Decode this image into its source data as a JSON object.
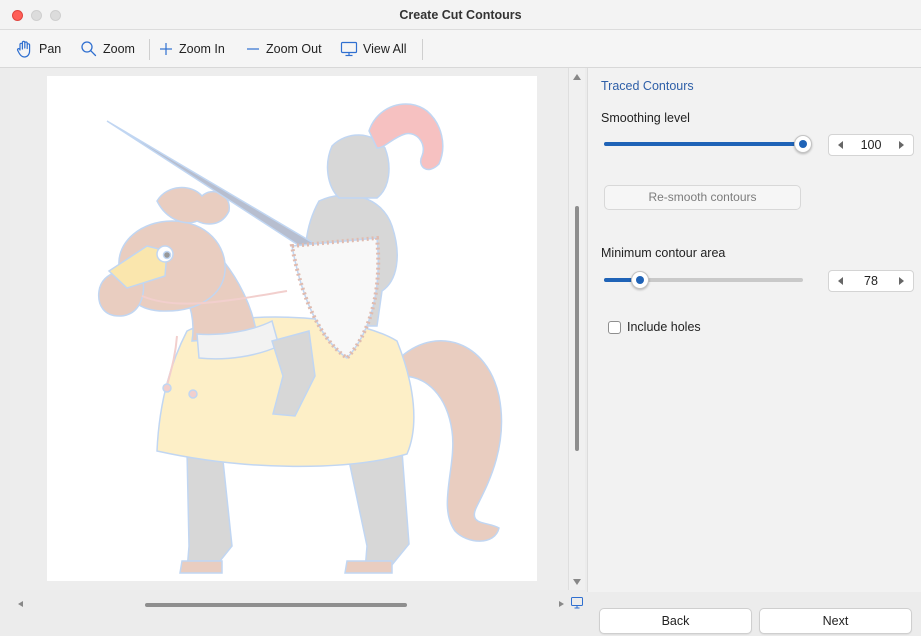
{
  "window": {
    "title": "Create Cut Contours"
  },
  "toolbar": {
    "pan": {
      "label": "Pan",
      "icon": "hand-icon"
    },
    "zoom": {
      "label": "Zoom",
      "icon": "magnifier-icon"
    },
    "zoom_in": {
      "label": "Zoom In",
      "icon": "plus-icon"
    },
    "zoom_out": {
      "label": "Zoom Out",
      "icon": "minus-icon"
    },
    "view_all": {
      "label": "View All",
      "icon": "monitor-icon"
    }
  },
  "panel": {
    "heading": "Traced Contours",
    "smoothing": {
      "label": "Smoothing level",
      "value": "100",
      "fraction": 1.0
    },
    "resmooth_button": "Re-smooth contours",
    "min_area": {
      "label": "Minimum contour area",
      "value": "78",
      "fraction": 0.18
    },
    "include_holes": {
      "label": "Include holes",
      "checked": false
    }
  },
  "footer": {
    "back": "Back",
    "next": "Next"
  },
  "colors": {
    "accent": "#1f63b7",
    "heading": "#2e5fa8",
    "contour_outline": "#8fb6e8"
  }
}
